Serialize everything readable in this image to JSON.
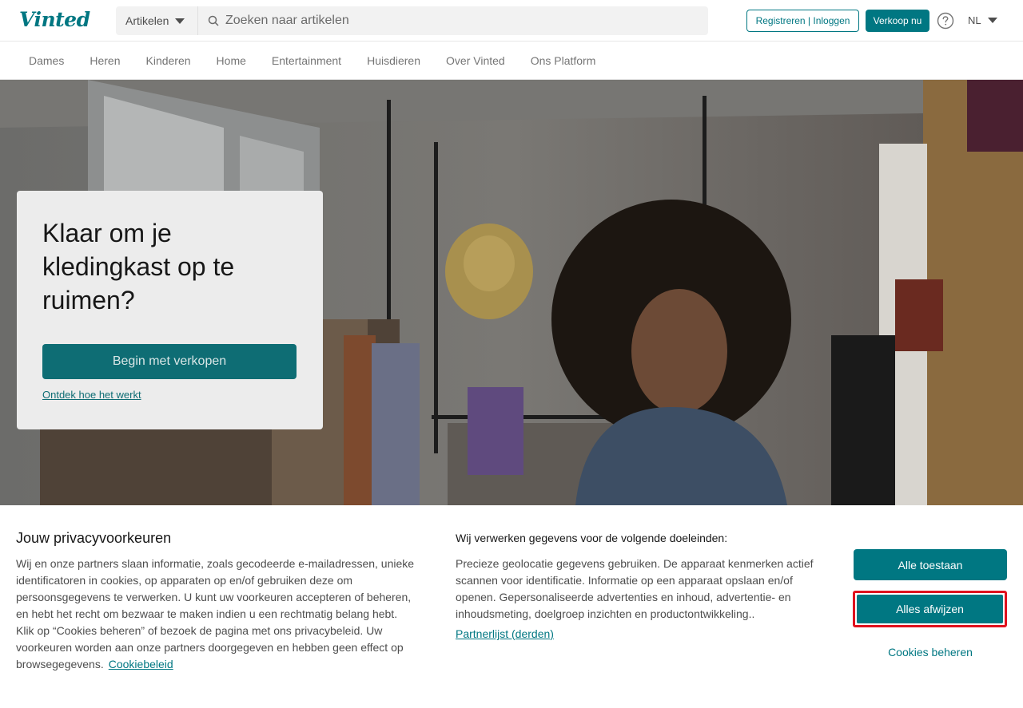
{
  "header": {
    "logo": "Vinted",
    "search": {
      "category": "Artikelen",
      "placeholder": "Zoeken naar artikelen"
    },
    "register_label": "Registreren | Inloggen",
    "sell_label": "Verkoop nu",
    "language": "NL"
  },
  "nav": {
    "items": [
      "Dames",
      "Heren",
      "Kinderen",
      "Home",
      "Entertainment",
      "Huisdieren",
      "Over Vinted",
      "Ons Platform"
    ]
  },
  "hero": {
    "title": "Klaar om je kledingkast op te ruimen?",
    "cta_label": "Begin met verkopen",
    "link_label": "Ontdek hoe het werkt"
  },
  "cookie": {
    "title": "Jouw privacyvoorkeuren",
    "text": "Wij en onze partners slaan informatie, zoals gecodeerde e-mailadressen, unieke identificatoren in cookies, op apparaten op en/of gebruiken deze om persoonsgegevens te verwerken. U kunt uw voorkeuren accepteren of beheren, en hebt het recht om bezwaar te maken indien u een rechtmatig belang hebt. Klik op “Cookies beheren” of bezoek de pagina met ons privacybeleid. Uw voorkeuren worden aan onze partners doorgegeven en hebben geen effect op browsegegevens.",
    "policy_link": "Cookiebeleid",
    "purposes_title": "Wij verwerken gegevens voor de volgende doeleinden:",
    "purposes_text": "Precieze geolocatie gegevens gebruiken. De apparaat kenmerken actief scannen voor identificatie. Informatie op een apparaat opslaan en/of openen. Gepersonaliseerde advertenties en inhoud, advertentie- en inhoudsmeting, doelgroep inzichten en productontwikkeling..",
    "partner_link": "Partnerlijst (derden)",
    "accept_label": "Alle toestaan",
    "reject_label": "Alles afwijzen",
    "manage_label": "Cookies beheren"
  },
  "colors": {
    "brand": "#007782",
    "highlight": "#e0121e"
  }
}
